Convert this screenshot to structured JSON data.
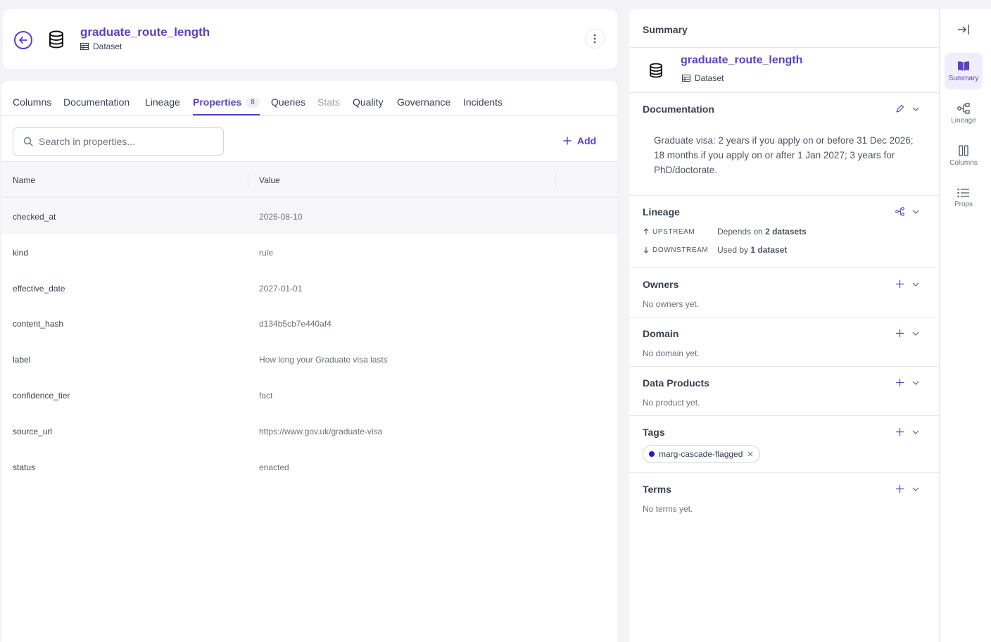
{
  "header": {
    "title": "graduate_route_length",
    "type_label": "Dataset"
  },
  "tabs": [
    {
      "label": "Columns"
    },
    {
      "label": "Documentation"
    },
    {
      "label": "Lineage"
    },
    {
      "label": "Properties",
      "badge": "8"
    },
    {
      "label": "Queries"
    },
    {
      "label": "Stats"
    },
    {
      "label": "Quality"
    },
    {
      "label": "Governance"
    },
    {
      "label": "Incidents"
    }
  ],
  "properties": {
    "search_placeholder": "Search in properties...",
    "add_label": "Add",
    "columns": {
      "name": "Name",
      "value": "Value"
    },
    "rows": [
      {
        "name": "checked_at",
        "value": "2026-08-10"
      },
      {
        "name": "kind",
        "value": "rule"
      },
      {
        "name": "effective_date",
        "value": "2027-01-01"
      },
      {
        "name": "content_hash",
        "value": "d134b5cb7e440af4"
      },
      {
        "name": "label",
        "value": "How long your Graduate visa lasts"
      },
      {
        "name": "confidence_tier",
        "value": "fact"
      },
      {
        "name": "source_url",
        "value": "https://www.gov.uk/graduate-visa"
      },
      {
        "name": "status",
        "value": "enacted"
      }
    ]
  },
  "summary": {
    "heading": "Summary",
    "title": "graduate_route_length",
    "type_label": "Dataset",
    "documentation": {
      "title": "Documentation",
      "text": "Graduate visa: 2 years if you apply on or before 31 Dec 2026; 18 months if you apply on or after 1 Jan 2027; 3 years for PhD/doctorate."
    },
    "lineage": {
      "title": "Lineage",
      "upstream_label": "UPSTREAM",
      "upstream_prefix": "Depends on",
      "upstream_count": "2 datasets",
      "downstream_label": "DOWNSTREAM",
      "downstream_prefix": "Used by",
      "downstream_count": "1 dataset"
    },
    "owners": {
      "title": "Owners",
      "empty": "No owners yet."
    },
    "domain": {
      "title": "Domain",
      "empty": "No domain yet."
    },
    "data_products": {
      "title": "Data Products",
      "empty": "No product yet."
    },
    "tags": {
      "title": "Tags",
      "items": [
        {
          "label": "marg-cascade-flagged",
          "color": "#1d1dd6"
        }
      ]
    },
    "terms": {
      "title": "Terms",
      "empty": "No terms yet."
    }
  },
  "rail": [
    {
      "label": "Summary",
      "icon": "book-icon"
    },
    {
      "label": "Lineage",
      "icon": "lineage-icon"
    },
    {
      "label": "Columns",
      "icon": "columns-icon"
    },
    {
      "label": "Props",
      "icon": "list-icon"
    }
  ],
  "colors": {
    "accent": "#5b3fc4"
  }
}
